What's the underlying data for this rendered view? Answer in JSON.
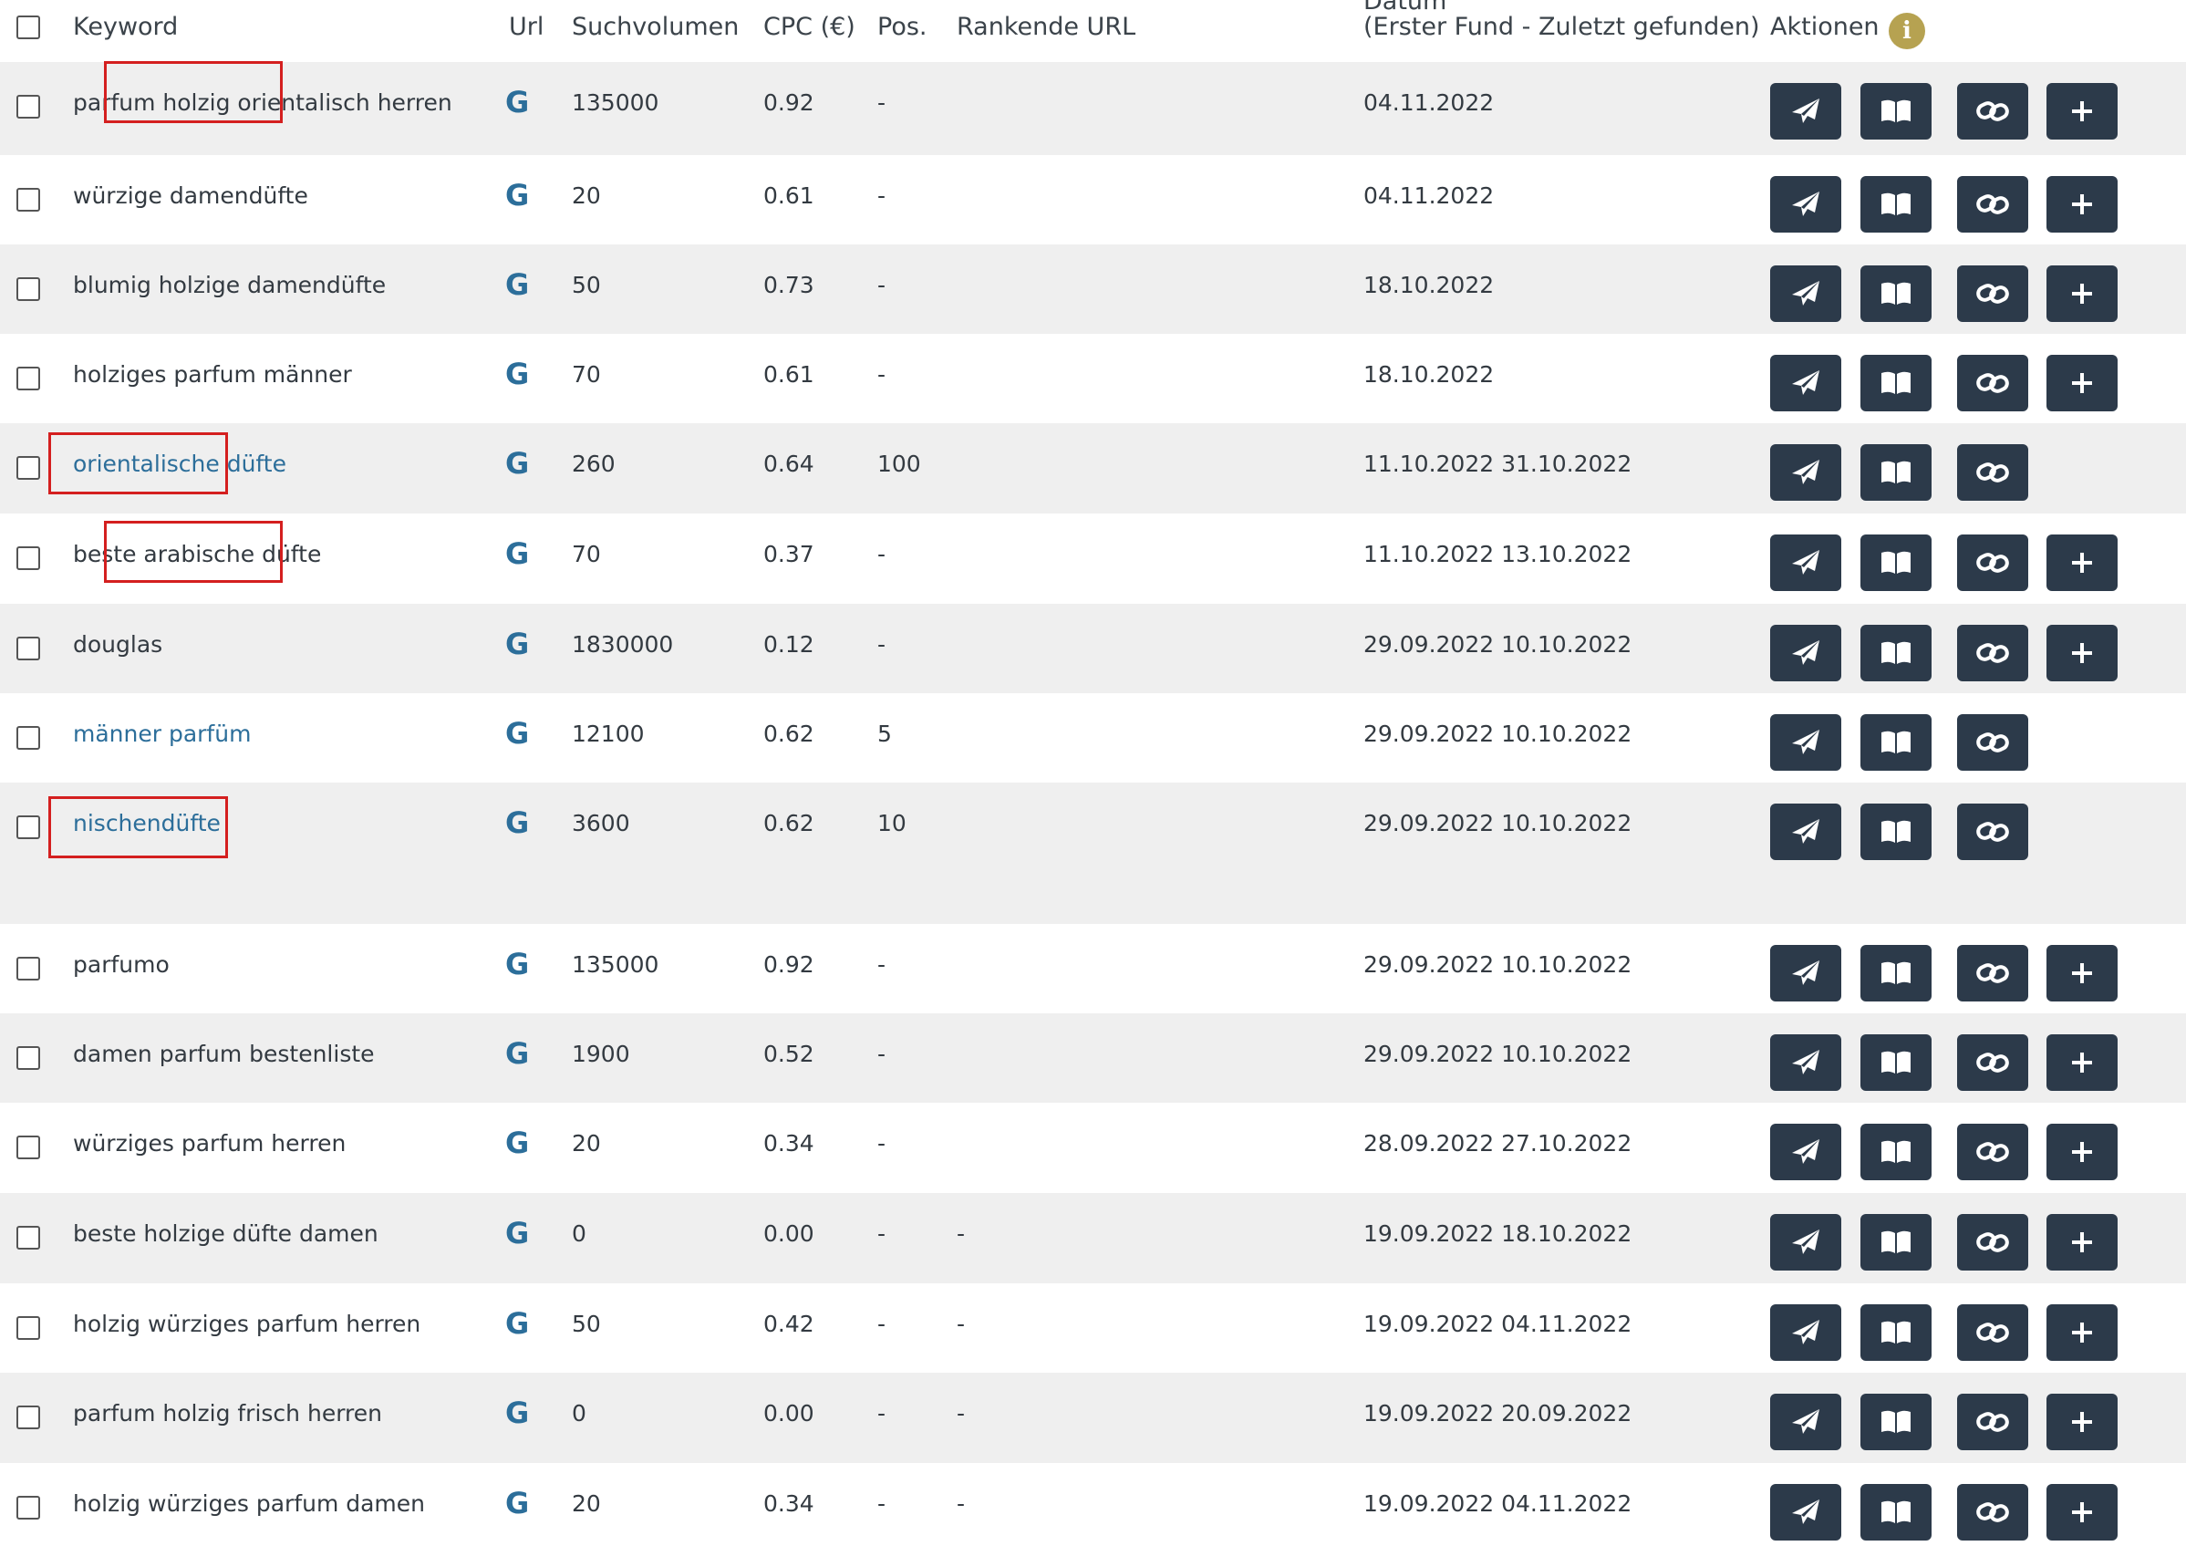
{
  "header": {
    "keyword": "Keyword",
    "url": "Url",
    "volume": "Suchvolumen",
    "cpc": "CPC (€)",
    "pos": "Pos.",
    "ranking_url": "Rankende URL",
    "date_top": "Datum",
    "date": "(Erster Fund - Zuletzt gefunden)",
    "actions": "Aktionen",
    "info_icon": "i"
  },
  "icons": {
    "url": "google-g-icon",
    "send": "paper-plane-icon",
    "book": "book-open-icon",
    "link": "link-icon",
    "add": "plus-icon"
  },
  "colors": {
    "button_bg": "#2c3a4a",
    "link_text": "#2c6e9a",
    "info_badge": "#b6a251",
    "highlight": "#d41f1f",
    "row_alt": "#efefef"
  },
  "rows": [
    {
      "keyword": "parfum holzig orientalisch herren",
      "url_icon": "G",
      "volume": "135000",
      "cpc": "0.92",
      "pos": "-",
      "ranking_url": "",
      "date": "04.11.2022",
      "linked": false,
      "has_add": true
    },
    {
      "keyword": "würzige damendüfte",
      "url_icon": "G",
      "volume": "20",
      "cpc": "0.61",
      "pos": "-",
      "ranking_url": "",
      "date": "04.11.2022",
      "linked": false,
      "has_add": true
    },
    {
      "keyword": "blumig holzige damendüfte",
      "url_icon": "G",
      "volume": "50",
      "cpc": "0.73",
      "pos": "-",
      "ranking_url": "",
      "date": "18.10.2022",
      "linked": false,
      "has_add": true
    },
    {
      "keyword": "holziges parfum männer",
      "url_icon": "G",
      "volume": "70",
      "cpc": "0.61",
      "pos": "-",
      "ranking_url": "",
      "date": "18.10.2022",
      "linked": false,
      "has_add": true
    },
    {
      "keyword": "orientalische düfte",
      "url_icon": "G",
      "volume": "260",
      "cpc": "0.64",
      "pos": "100",
      "ranking_url": "",
      "date": "11.10.2022 31.10.2022",
      "linked": true,
      "has_add": false
    },
    {
      "keyword": "beste arabische düfte",
      "url_icon": "G",
      "volume": "70",
      "cpc": "0.37",
      "pos": "-",
      "ranking_url": "",
      "date": "11.10.2022 13.10.2022",
      "linked": false,
      "has_add": true
    },
    {
      "keyword": "douglas",
      "url_icon": "G",
      "volume": "1830000",
      "cpc": "0.12",
      "pos": "-",
      "ranking_url": "",
      "date": "29.09.2022 10.10.2022",
      "linked": false,
      "has_add": true
    },
    {
      "keyword": "männer parfüm",
      "url_icon": "G",
      "volume": "12100",
      "cpc": "0.62",
      "pos": "5",
      "ranking_url": "",
      "date": "29.09.2022 10.10.2022",
      "linked": true,
      "has_add": false
    },
    {
      "keyword": "nischendüfte",
      "url_icon": "G",
      "volume": "3600",
      "cpc": "0.62",
      "pos": "10",
      "ranking_url": "",
      "date": "29.09.2022 10.10.2022",
      "linked": true,
      "has_add": false
    },
    {
      "keyword": "parfumo",
      "url_icon": "G",
      "volume": "135000",
      "cpc": "0.92",
      "pos": "-",
      "ranking_url": "",
      "date": "29.09.2022 10.10.2022",
      "linked": false,
      "has_add": true
    },
    {
      "keyword": "damen parfum bestenliste",
      "url_icon": "G",
      "volume": "1900",
      "cpc": "0.52",
      "pos": "-",
      "ranking_url": "",
      "date": "29.09.2022 10.10.2022",
      "linked": false,
      "has_add": true
    },
    {
      "keyword": "würziges parfum herren",
      "url_icon": "G",
      "volume": "20",
      "cpc": "0.34",
      "pos": "-",
      "ranking_url": "",
      "date": "28.09.2022 27.10.2022",
      "linked": false,
      "has_add": true
    },
    {
      "keyword": "beste holzige düfte damen",
      "url_icon": "G",
      "volume": "0",
      "cpc": "0.00",
      "pos": "-",
      "ranking_url": "-",
      "date": "19.09.2022 18.10.2022",
      "linked": false,
      "has_add": true
    },
    {
      "keyword": "holzig würziges parfum herren",
      "url_icon": "G",
      "volume": "50",
      "cpc": "0.42",
      "pos": "-",
      "ranking_url": "-",
      "date": "19.09.2022 04.11.2022",
      "linked": false,
      "has_add": true
    },
    {
      "keyword": "parfum holzig frisch herren",
      "url_icon": "G",
      "volume": "0",
      "cpc": "0.00",
      "pos": "-",
      "ranking_url": "-",
      "date": "19.09.2022 20.09.2022",
      "linked": false,
      "has_add": true
    },
    {
      "keyword": "holzig würziges parfum damen",
      "url_icon": "G",
      "volume": "20",
      "cpc": "0.34",
      "pos": "-",
      "ranking_url": "-",
      "date": "19.09.2022 04.11.2022",
      "linked": false,
      "has_add": true
    }
  ]
}
